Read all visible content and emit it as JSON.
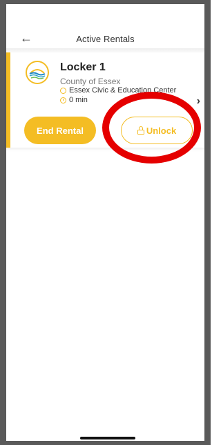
{
  "header": {
    "title": "Active Rentals",
    "back_icon": "arrow-left-icon"
  },
  "rental": {
    "locker_name": "Locker 1",
    "organization": "County of Essex",
    "location": "Essex Civic & Education Center",
    "elapsed": "0 min",
    "end_label": "End Rental",
    "unlock_label": "Unlock"
  },
  "colors": {
    "accent": "#f4bd24",
    "annotation": "#e50000"
  }
}
